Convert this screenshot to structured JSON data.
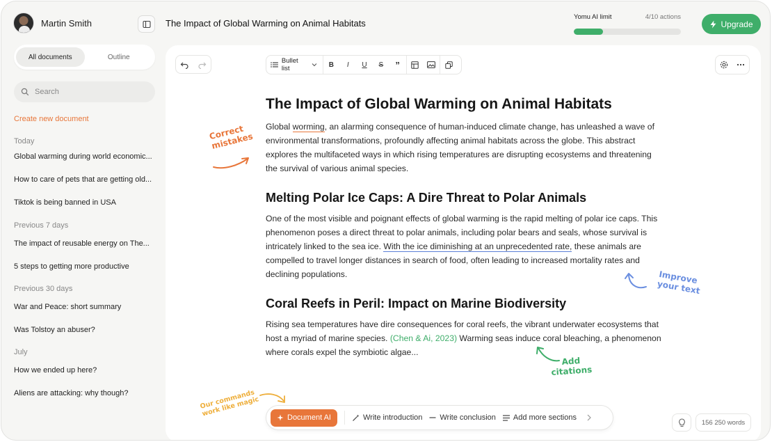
{
  "user": {
    "name": "Martin Smith"
  },
  "document": {
    "title": "The Impact of Global Warming on Animal Habitats"
  },
  "ai_limit": {
    "label": "Yomu AI limit",
    "count": "4/10 actions",
    "progress": 0.27
  },
  "upgrade": {
    "label": "Upgrade"
  },
  "sidebar": {
    "tabs": [
      "All documents",
      "Outline"
    ],
    "search_placeholder": "Search",
    "create_label": "Create new document",
    "groups": [
      {
        "label": "Today",
        "items": [
          "Global warming during world economic...",
          "How to care of pets that are getting old...",
          "Tiktok is being banned in USA"
        ]
      },
      {
        "label": "Previous 7 days",
        "items": [
          "The impact of reusable energy on The...",
          "5 steps to getting more productive"
        ]
      },
      {
        "label": "Previous 30 days",
        "items": [
          "War and Peace: short summary",
          "Was Tolstoy an abuser?"
        ]
      },
      {
        "label": "July",
        "items": [
          "How we ended up here?",
          "Aliens are attacking: why though?"
        ]
      }
    ]
  },
  "toolbar": {
    "style_select": "Bullet list",
    "bold": "B",
    "italic": "I",
    "underline": "U",
    "strike": "S",
    "quote": "”"
  },
  "content": {
    "h1": "The Impact of Global Warming on Animal Habitats",
    "p1_pre": "Global ",
    "p1_mark": "worming",
    "p1_post": ", an alarming consequence of human-induced climate change, has unleashed a wave of environmental transformations, profoundly affecting animal habitats across the globe. This abstract explores the multifaceted ways in which rising temperatures are disrupting ecosystems and threatening the survival of various animal species.",
    "h2a": "Melting Polar Ice Caps: A Dire Threat to Polar Animals",
    "p2_pre": "One of the most visible and poignant effects of global warming is the rapid melting of polar ice caps. This phenomenon poses a direct threat to polar animals, including polar bears and seals, whose survival is intricately linked to the sea ice. ",
    "p2_mark": "With the ice diminishing at an unprecedented rate,",
    "p2_post": " these animals are compelled to travel longer distances in search of food, often leading to increased mortality rates and declining populations.",
    "h2b": "Coral Reefs in Peril: Impact on Marine Biodiversity",
    "p3_pre": "Rising sea temperatures have dire consequences for coral reefs, the vibrant underwater ecosystems that host a myriad of marine species. ",
    "p3_cite": "(Chen & Ai, 2023)",
    "p3_post": " Warming seas induce coral bleaching, a phenomenon where corals expel the symbiotic algae..."
  },
  "annotations": {
    "correct": [
      "Correct",
      "mistakes"
    ],
    "improve": [
      "Improve",
      "your text"
    ],
    "citations": [
      "Add",
      "citations"
    ],
    "commands": [
      "Our commands",
      "work like magic"
    ]
  },
  "commands": {
    "document_ai": "Document AI",
    "write_intro": "Write introduction",
    "write_conclusion": "Write conclusion",
    "add_sections": "Add more sections"
  },
  "word_count": "156 250 words",
  "colors": {
    "accent_green": "#3fae6a",
    "accent_orange": "#e8763a",
    "accent_blue": "#5b7fd6"
  }
}
